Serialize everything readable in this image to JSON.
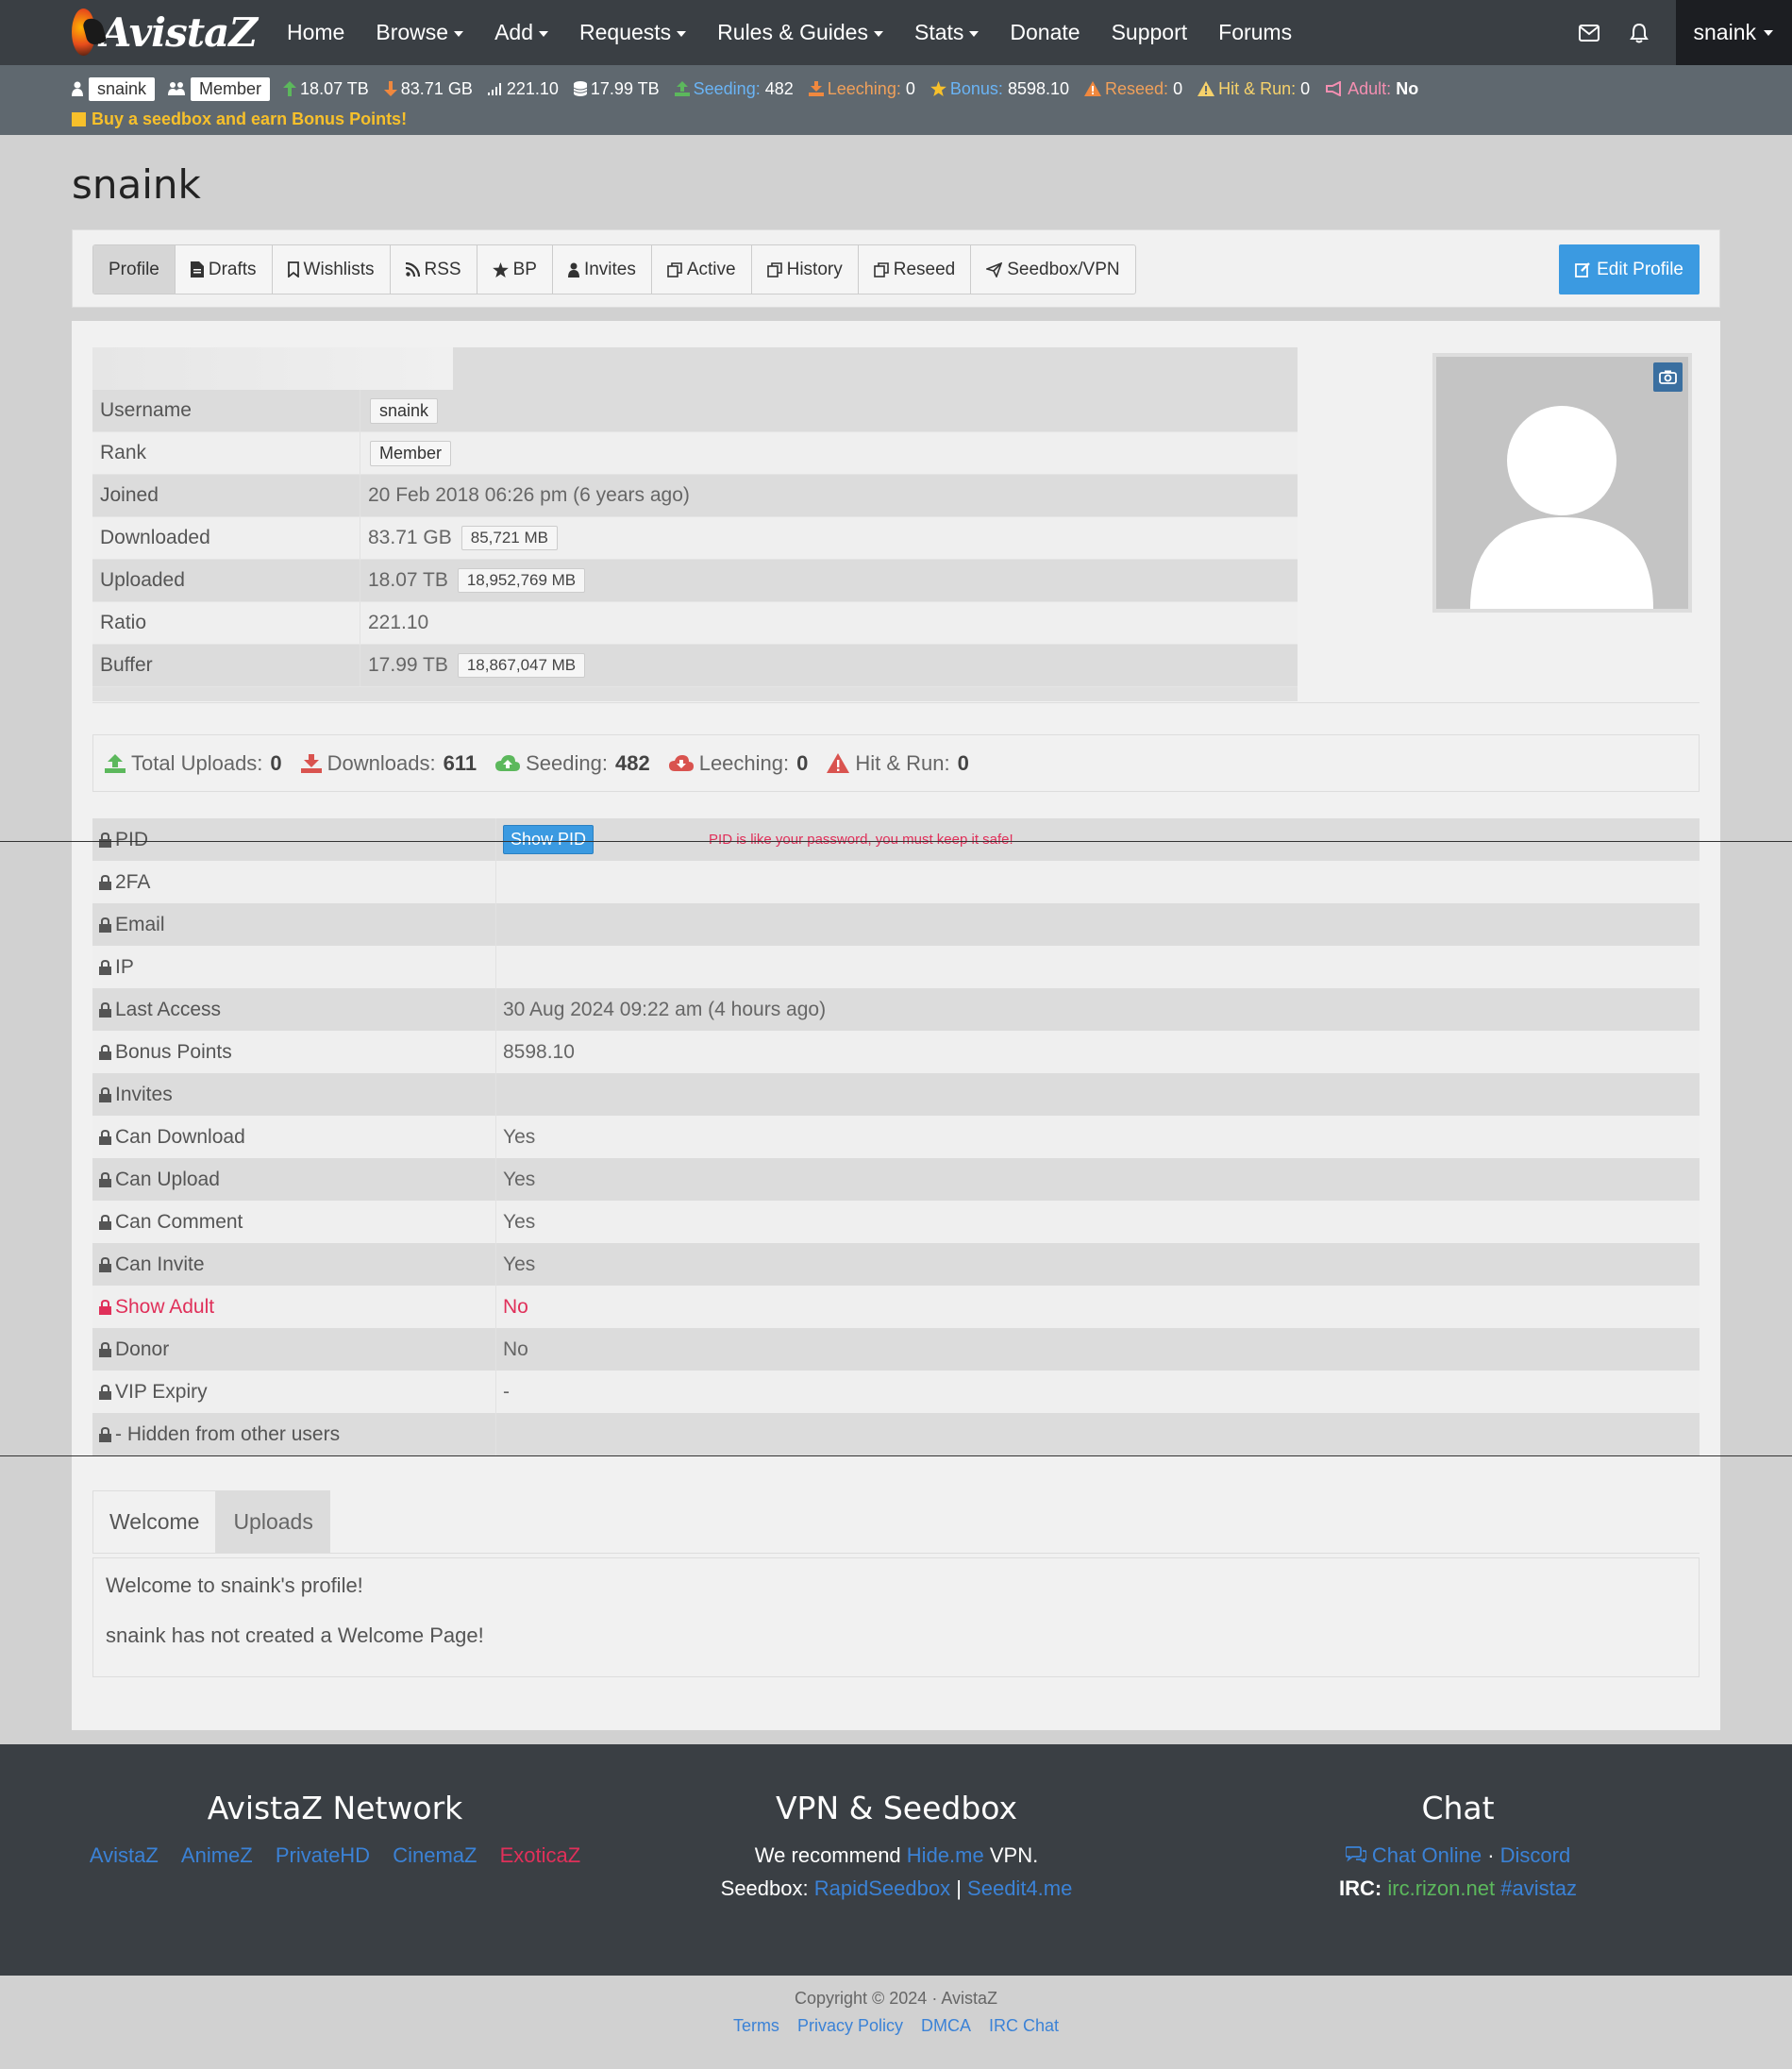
{
  "nav": {
    "logo_text": "AvistaZ",
    "items": [
      {
        "label": "Home",
        "dropdown": false
      },
      {
        "label": "Browse",
        "dropdown": true
      },
      {
        "label": "Add",
        "dropdown": true
      },
      {
        "label": "Requests",
        "dropdown": true
      },
      {
        "label": "Rules & Guides",
        "dropdown": true
      },
      {
        "label": "Stats",
        "dropdown": true
      },
      {
        "label": "Donate",
        "dropdown": false
      },
      {
        "label": "Support",
        "dropdown": false
      },
      {
        "label": "Forums",
        "dropdown": false
      }
    ],
    "user": "snaink"
  },
  "stats": {
    "username": "snaink",
    "rank": "Member",
    "uploaded": "18.07 TB",
    "downloaded": "83.71 GB",
    "ratio": "221.10",
    "buffer": "17.99 TB",
    "seeding_label": "Seeding:",
    "seeding": "482",
    "leeching_label": "Leeching:",
    "leeching": "0",
    "bonus_label": "Bonus:",
    "bonus": "8598.10",
    "reseed_label": "Reseed:",
    "reseed": "0",
    "hnr_label": "Hit & Run:",
    "hnr": "0",
    "adult_label": "Adult:",
    "adult": "No",
    "promo": "Buy a seedbox and earn Bonus Points!"
  },
  "page_title": "snaink",
  "tabs": [
    {
      "label": "Profile",
      "icon": "none"
    },
    {
      "label": "Drafts",
      "icon": "file-icon"
    },
    {
      "label": "Wishlists",
      "icon": "bookmark-icon"
    },
    {
      "label": "RSS",
      "icon": "rss-icon"
    },
    {
      "label": "BP",
      "icon": "star-icon"
    },
    {
      "label": "Invites",
      "icon": "user-icon"
    },
    {
      "label": "Active",
      "icon": "copy-icon"
    },
    {
      "label": "History",
      "icon": "copy-icon"
    },
    {
      "label": "Reseed",
      "icon": "copy-icon"
    },
    {
      "label": "Seedbox/VPN",
      "icon": "send-icon"
    }
  ],
  "edit_profile": "Edit Profile",
  "info": {
    "username_label": "Username",
    "username": "snaink",
    "rank_label": "Rank",
    "rank": "Member",
    "joined_label": "Joined",
    "joined": "20 Feb 2018 06:26 pm (6 years ago)",
    "downloaded_label": "Downloaded",
    "downloaded": "83.71 GB",
    "downloaded_mb": "85,721 MB",
    "uploaded_label": "Uploaded",
    "uploaded": "18.07 TB",
    "uploaded_mb": "18,952,769 MB",
    "ratio_label": "Ratio",
    "ratio": "221.10",
    "buffer_label": "Buffer",
    "buffer": "17.99 TB",
    "buffer_mb": "18,867,047 MB"
  },
  "summary": {
    "uploads_label": "Total Uploads:",
    "uploads": "0",
    "downloads_label": "Downloads:",
    "downloads": "611",
    "seeding_label": "Seeding:",
    "seeding": "482",
    "leeching_label": "Leeching:",
    "leeching": "0",
    "hnr_label": "Hit & Run:",
    "hnr": "0"
  },
  "private": {
    "pid_label": "PID",
    "pid_button": "Show PID",
    "pid_note": "PID is like your password, you must keep it safe!",
    "twofa_label": "2FA",
    "twofa": "",
    "email_label": "Email",
    "email": "",
    "ip_label": "IP",
    "ip": "",
    "last_access_label": "Last Access",
    "last_access": "30 Aug 2024 09:22 am (4 hours ago)",
    "bonus_label": "Bonus Points",
    "bonus": "8598.10",
    "invites_label": "Invites",
    "invites": "",
    "can_download_label": "Can Download",
    "can_download": "Yes",
    "can_upload_label": "Can Upload",
    "can_upload": "Yes",
    "can_comment_label": "Can Comment",
    "can_comment": "Yes",
    "can_invite_label": "Can Invite",
    "can_invite": "Yes",
    "show_adult_label": "Show Adult",
    "show_adult": "No",
    "donor_label": "Donor",
    "donor": "No",
    "vip_label": "VIP Expiry",
    "vip": "-",
    "hidden_label": "- Hidden from other users"
  },
  "welcome": {
    "tab_welcome": "Welcome",
    "tab_uploads": "Uploads",
    "line1": "Welcome to snaink's profile!",
    "line2": "snaink has not created a Welcome Page!"
  },
  "footer": {
    "network_title": "AvistaZ Network",
    "network_links": [
      "AvistaZ",
      "AnimeZ",
      "PrivateHD",
      "CinemaZ",
      "ExoticaZ"
    ],
    "vpn_title": "VPN & Seedbox",
    "vpn_pre": "We recommend",
    "vpn_link": "Hide.me",
    "vpn_post": "VPN.",
    "seedbox_pre": "Seedbox:",
    "seedbox_link1": "RapidSeedbox",
    "seedbox_sep": "|",
    "seedbox_link2": "Seedit4.me",
    "chat_title": "Chat",
    "chat_online": "Chat Online",
    "chat_dot": "·",
    "chat_discord": "Discord",
    "irc_label": "IRC:",
    "irc_server": "irc.rizon.net",
    "irc_channel": "#avistaz",
    "copyright": "Copyright © 2024 · AvistaZ",
    "links": [
      "Terms",
      "Privacy Policy",
      "DMCA",
      "IRC Chat"
    ]
  }
}
